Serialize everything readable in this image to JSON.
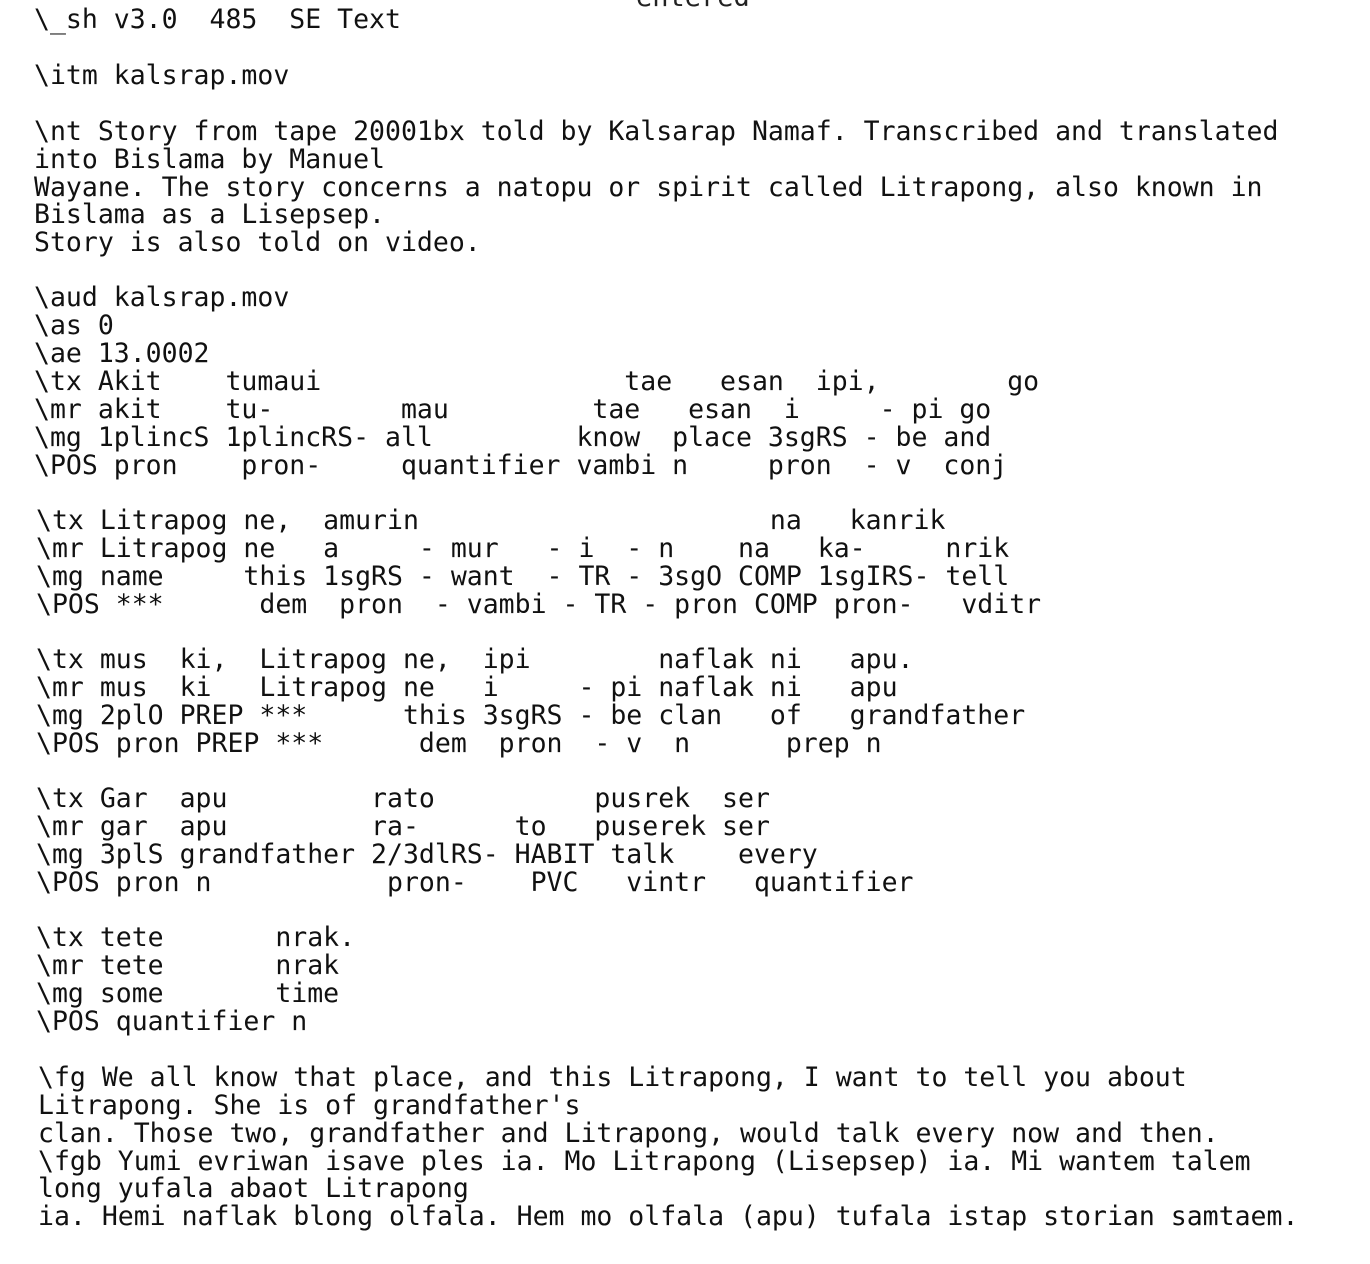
{
  "header": {
    "cut_off_text": "entered",
    "shell_line": "\\_sh v3.0  485  SE Text"
  },
  "item": "\\itm kalsrap.mov",
  "note": {
    "line1": "\\nt Story from tape 20001bx told by Kalsarap Namaf. Transcribed and translated",
    "line2": "into Bislama by Manuel",
    "line3": "Wayane. The story concerns a natopu or spirit called Litrapong, also known in",
    "line4": "Bislama as a Lisepsep.",
    "line5": "Story is also told on video."
  },
  "audio": {
    "aud": "\\aud kalsrap.mov",
    "as": "\\as 0",
    "ae": "\\ae 13.0002"
  },
  "blocks": [
    {
      "tx": "\\tx Akit    tumaui                   tae   esan  ipi,        go",
      "mr": "\\mr akit    tu-        mau         tae   esan  i     - pi go",
      "mg": "\\mg 1plincS 1plincRS- all         know  place 3sgRS - be and",
      "pos": "\\POS pron    pron-     quantifier vambi n     pron  - v  conj"
    },
    {
      "tx": "\\tx Litrapog ne,  amurin                      na   kanrik",
      "mr": "\\mr Litrapog ne   a     - mur   - i  - n    na   ka-     nrik",
      "mg": "\\mg name     this 1sgRS - want  - TR - 3sgO COMP 1sgIRS- tell",
      "pos": "\\POS ***      dem  pron  - vambi - TR - pron COMP pron-   vditr"
    },
    {
      "tx": "\\tx mus  ki,  Litrapog ne,  ipi        naflak ni   apu.",
      "mr": "\\mr mus  ki   Litrapog ne   i     - pi naflak ni   apu",
      "mg": "\\mg 2plO PREP ***      this 3sgRS - be clan   of   grandfather",
      "pos": "\\POS pron PREP ***      dem  pron  - v  n      prep n"
    },
    {
      "tx": "\\tx Gar  apu         rato          pusrek  ser",
      "mr": "\\mr gar  apu         ra-      to   puserek ser",
      "mg": "\\mg 3plS grandfather 2/3dlRS- HABIT talk    every",
      "pos": "\\POS pron n           pron-    PVC   vintr   quantifier"
    },
    {
      "tx": "\\tx tete       nrak.",
      "mr": "\\mr tete       nrak",
      "mg": "\\mg some       time",
      "pos": "\\POS quantifier n"
    }
  ],
  "free_translation": {
    "fg1": "\\fg We all know that place, and this Litrapong, I want to tell you about",
    "fg2": "Litrapong. She is of grandfather's",
    "fg3": "clan. Those two, grandfather and Litrapong, would talk every now and then.",
    "fgb1": "\\fgb Yumi evriwan isave ples ia. Mo Litrapong (Lisepsep) ia. Mi wantem talem",
    "fgb2": "long yufala abaot Litrapong",
    "fgb3": "ia. Hemi naflak blong olfala. Hem mo olfala (apu) tufala istap storian samtaem."
  }
}
